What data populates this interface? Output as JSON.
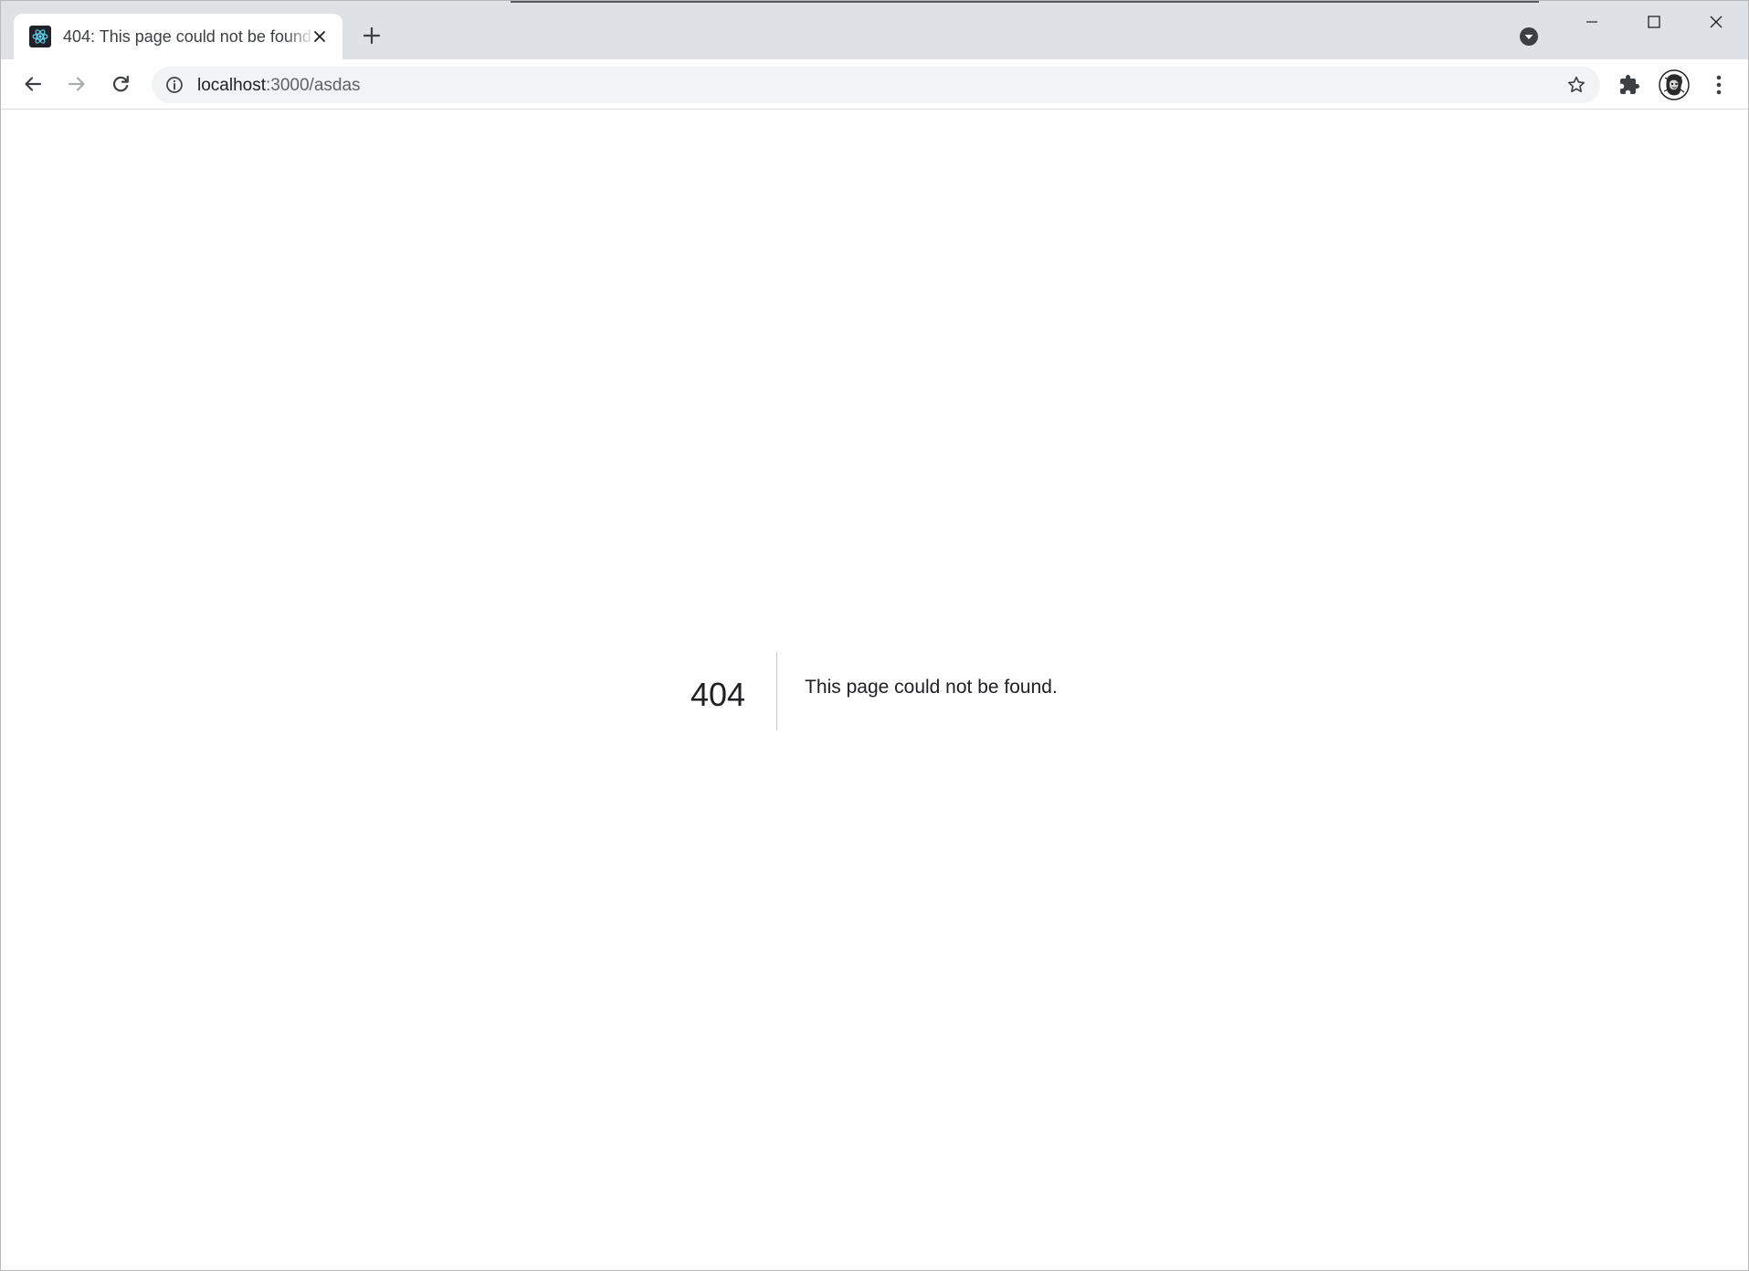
{
  "browser": {
    "tab": {
      "title": "404: This page could not be found",
      "favicon": "react-logo-icon"
    },
    "new_tab_icon": "plus-icon",
    "tab_search_icon": "chevron-down-icon",
    "window_controls": [
      "minimize-icon",
      "maximize-icon",
      "close-icon"
    ],
    "address_bar": {
      "host": "localhost",
      "path": ":3000/asdas"
    }
  },
  "page": {
    "error_code": "404",
    "error_message": "This page could not be found."
  },
  "colors": {
    "tabstrip_bg": "#dee1e6",
    "omnibox_bg": "#f1f3f4",
    "text": "#202124",
    "react_cyan": "#61dafb"
  }
}
